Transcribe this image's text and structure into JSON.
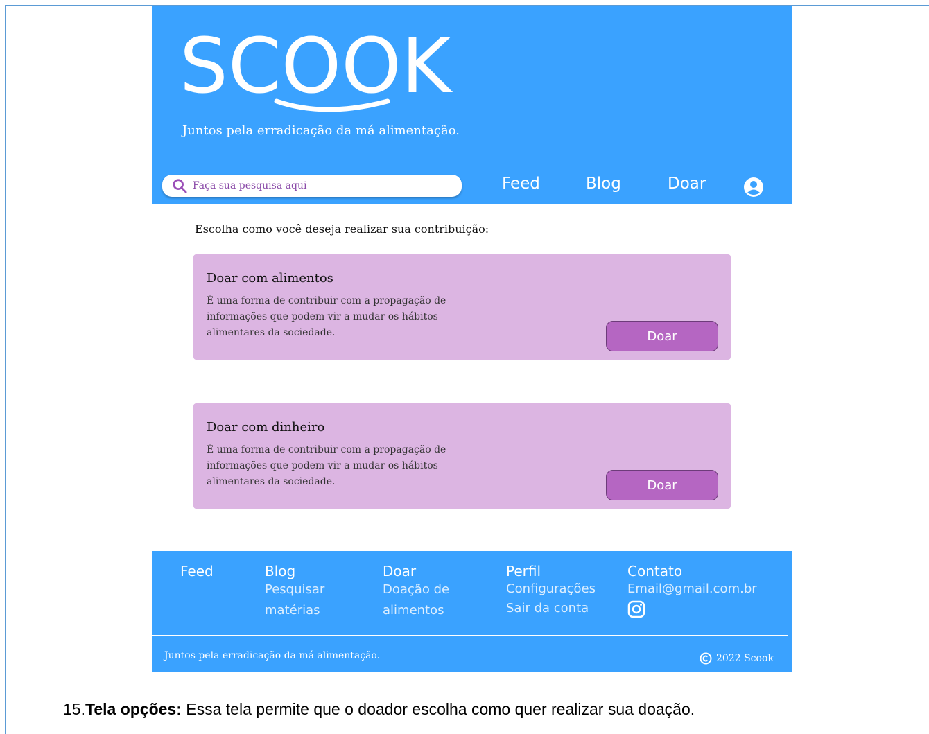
{
  "header": {
    "brand": "SCOOK",
    "tagline": "Juntos pela erradicação da má alimentação.",
    "search": {
      "placeholder": "Faça sua pesquisa aqui"
    },
    "nav": {
      "feed": "Feed",
      "blog": "Blog",
      "doar": "Doar"
    }
  },
  "main": {
    "prompt": "Escolha como você deseja realizar sua contribuição:",
    "cards": [
      {
        "title": "Doar com alimentos",
        "desc_lines": [
          "É uma forma de contribuir com a propagação de",
          "informações que podem vir a mudar os hábitos",
          "alimentares da sociedade."
        ],
        "button": "Doar"
      },
      {
        "title": "Doar com dinheiro",
        "desc_lines": [
          "É uma forma de contribuir com a propagação de",
          "informações que podem vir a mudar os hábitos",
          "alimentares da sociedade."
        ],
        "button": "Doar"
      }
    ]
  },
  "footer": {
    "feed": "Feed",
    "blog": {
      "title": "Blog",
      "links": [
        "Pesquisar",
        "matérias"
      ]
    },
    "doar": {
      "title": "Doar",
      "links": [
        "Doação de",
        "alimentos"
      ]
    },
    "perfil": {
      "title": "Perfil",
      "links": [
        "Configurações",
        "Sair da conta"
      ]
    },
    "contato": {
      "title": "Contato",
      "email": "Email@gmail.com.br"
    },
    "tagline": "Juntos pela erradicação da má alimentação.",
    "copyright": "2022 Scook"
  },
  "caption": {
    "number": "15.",
    "bold": "Tela opções:",
    "text": " Essa tela permite que o doador escolha como quer realizar sua doação."
  },
  "colors": {
    "header_bg": "#3aa2ff",
    "card_bg": "#dcb5e2",
    "button_bg": "#b566c2"
  },
  "icons": {
    "search": "search-icon",
    "user": "user-circle-icon",
    "instagram": "instagram-icon",
    "copyright": "copyright-icon"
  }
}
